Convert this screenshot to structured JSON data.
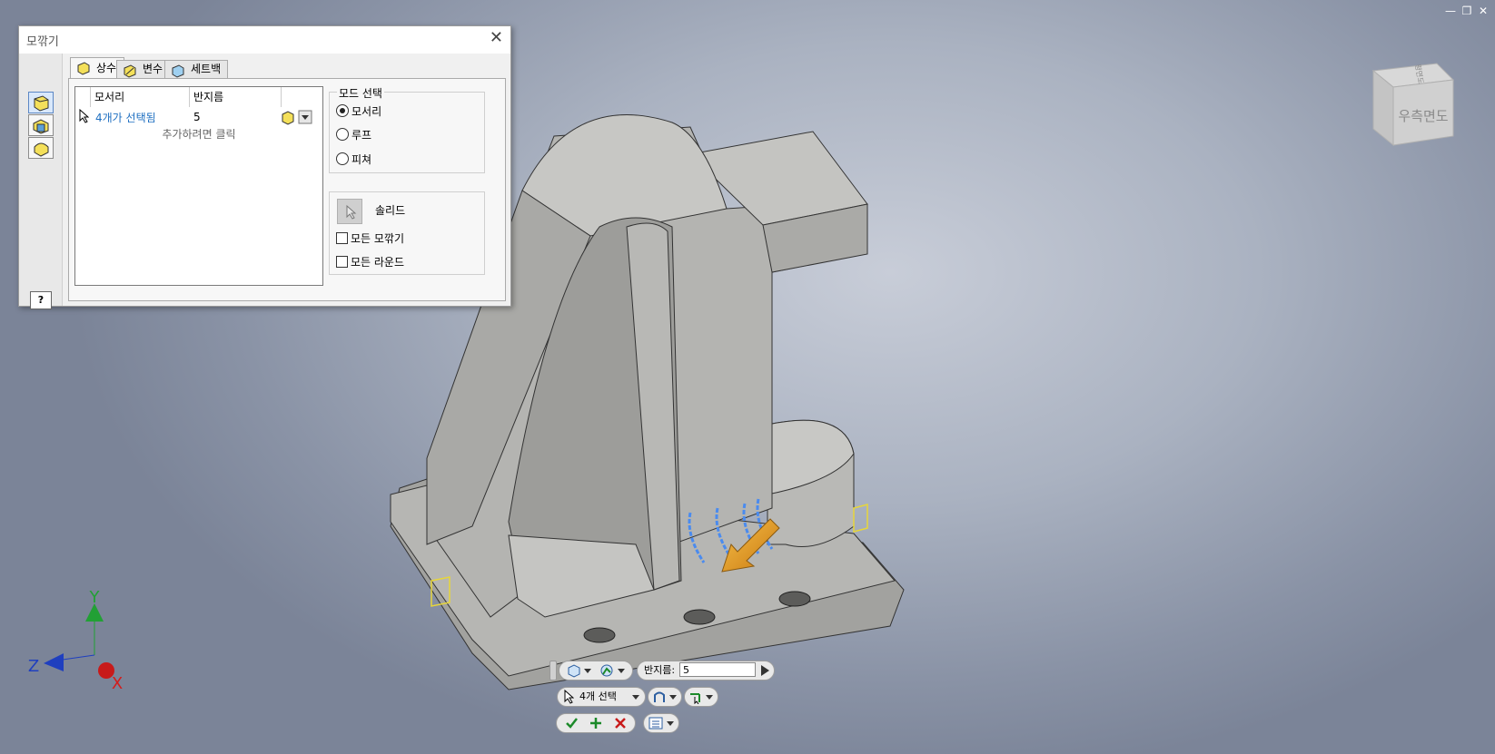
{
  "dialog": {
    "title": "모깎기",
    "tabs": [
      {
        "label": "상수",
        "active": true
      },
      {
        "label": "변수",
        "active": false
      },
      {
        "label": "세트백",
        "active": false
      }
    ],
    "grid": {
      "columns": [
        "모서리",
        "반지름"
      ],
      "rows": [
        {
          "edge": "4개가 선택됨",
          "radius": "5"
        }
      ],
      "add_hint": "추가하려면 클릭"
    },
    "mode": {
      "label": "모드 선택",
      "options": [
        {
          "label": "모서리",
          "selected": true
        },
        {
          "label": "루프",
          "selected": false
        },
        {
          "label": "피쳐",
          "selected": false
        }
      ]
    },
    "solid_label": "솔리드",
    "checkboxes": [
      {
        "label": "모든 모깎기",
        "checked": false
      },
      {
        "label": "모든 라운드",
        "checked": false
      }
    ],
    "help": "?"
  },
  "viewcube": {
    "face_label": "우측면도",
    "top_label": "평면도"
  },
  "triad": {
    "x": "X",
    "y": "Y",
    "z": "Z"
  },
  "mini_toolbar": {
    "radius_label": "반지름:",
    "radius_value": "5",
    "selection_label": "4개 선택"
  },
  "colors": {
    "accent": "#1e6fc1",
    "axis_x": "#d31c1c",
    "axis_y": "#22a035",
    "axis_z": "#1f3fbf",
    "arrow": "#e89a1f"
  }
}
